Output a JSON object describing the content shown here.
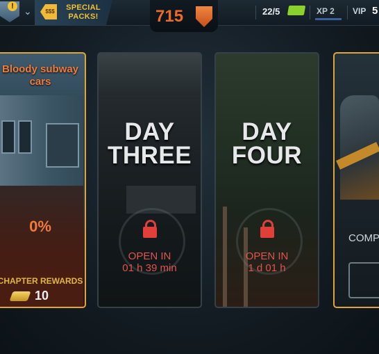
{
  "topbar": {
    "alert_badge": "!",
    "packs_tag": "$$$",
    "packs_label": "SPECIAL PACKS!",
    "currency_value": "715",
    "tickets": "22/5",
    "xp_label": "XP 2",
    "vip_label": "VIP",
    "vip_value": "5"
  },
  "icons": [
    "badge-icon",
    "chevron-down-icon",
    "price-tag-icon",
    "shield-icon",
    "ticket-icon",
    "lock-icon",
    "gold-bar-icon"
  ],
  "cards": [
    {
      "title": "Bloody subway cars",
      "progress": "0%",
      "rewards_label": "CHAPTER REWARDS",
      "rewards_value": "10"
    },
    {
      "title_line1": "DAY",
      "title_line2": "THREE",
      "open_in_label": "OPEN IN",
      "open_in_time": "01 h 39 min"
    },
    {
      "title_line1": "DAY",
      "title_line2": "FOUR",
      "open_in_label": "OPEN IN",
      "open_in_time": "1 d 01 h"
    },
    {
      "label": "COMP"
    }
  ],
  "colors": {
    "accent_orange": "#ee6a2a",
    "gold": "#e0a53a",
    "lock_red": "#e03f3a",
    "xp_blue": "#3d5ea0",
    "ticket_green": "#8bd12d"
  }
}
